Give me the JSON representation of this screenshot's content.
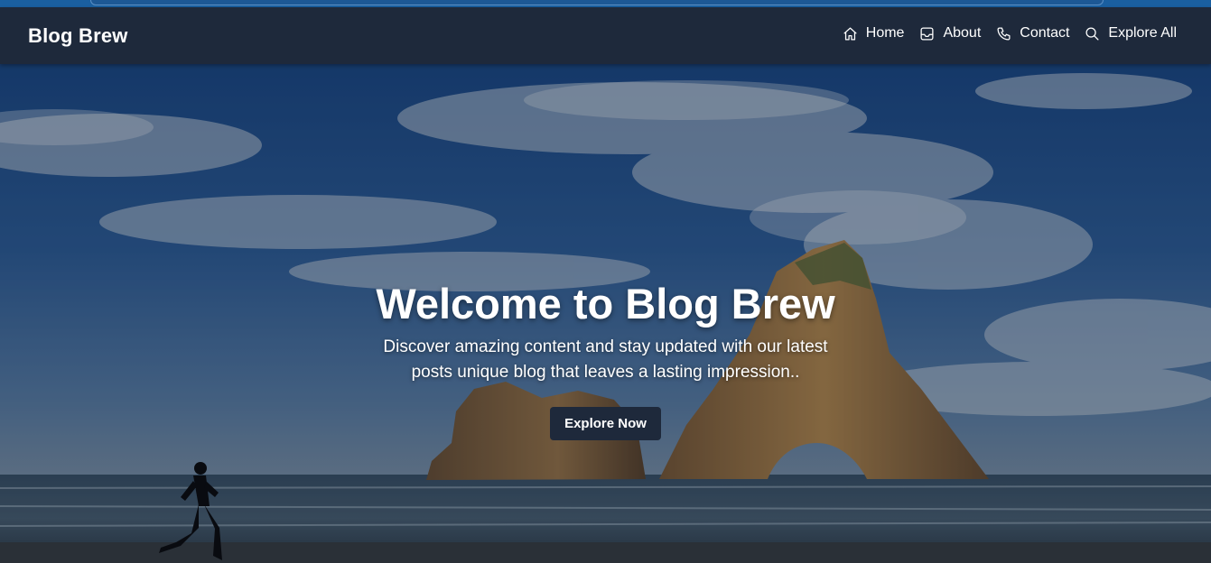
{
  "navbar": {
    "brand": "Blog Brew",
    "links": [
      {
        "label": "Home",
        "icon": "home-icon"
      },
      {
        "label": "About",
        "icon": "inbox-icon"
      },
      {
        "label": "Contact",
        "icon": "phone-icon"
      },
      {
        "label": "Explore All",
        "icon": "search-icon"
      }
    ]
  },
  "hero": {
    "title": "Welcome to Blog Brew",
    "subtitle": "Discover amazing content and stay updated with our latest posts unique blog that leaves a lasting impression..",
    "button_label": "Explore Now",
    "background_image": "beach-sea-stacks-runner-photo"
  },
  "colors": {
    "navbar_bg": "#1e293b",
    "button_bg": "#1e293b",
    "text": "#ffffff",
    "browser_strip": "#1a5fa0"
  }
}
